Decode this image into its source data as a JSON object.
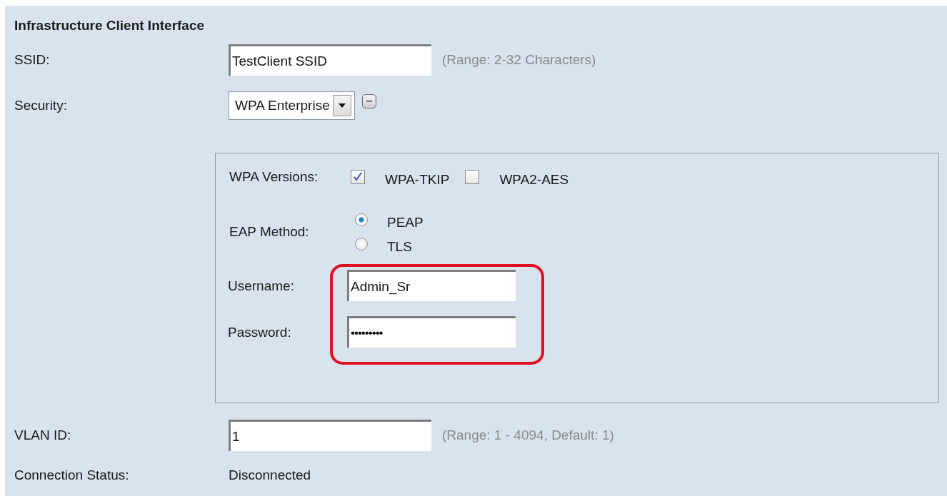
{
  "section": {
    "title": "Infrastructure Client Interface"
  },
  "ssid": {
    "label": "SSID:",
    "value": "TestClient SSID",
    "hint": "(Range: 2-32 Characters)"
  },
  "security": {
    "label": "Security:",
    "value": "WPA Enterprise",
    "expanded": true
  },
  "wpa_versions": {
    "label": "WPA Versions:",
    "options": [
      {
        "label": "WPA-TKIP",
        "checked": true
      },
      {
        "label": "WPA2-AES",
        "checked": false
      }
    ]
  },
  "eap_method": {
    "label": "EAP Method:",
    "options": [
      {
        "label": "PEAP",
        "selected": true
      },
      {
        "label": "TLS",
        "selected": false
      }
    ]
  },
  "username": {
    "label": "Username:",
    "value": "Admin_Sr"
  },
  "password": {
    "label": "Password:",
    "value": "•••••••••"
  },
  "vlan_id": {
    "label": "VLAN ID:",
    "value": "1",
    "hint": "(Range: 1 - 4094, Default: 1)"
  },
  "connection_status": {
    "label": "Connection Status:",
    "value": "Disconnected"
  }
}
